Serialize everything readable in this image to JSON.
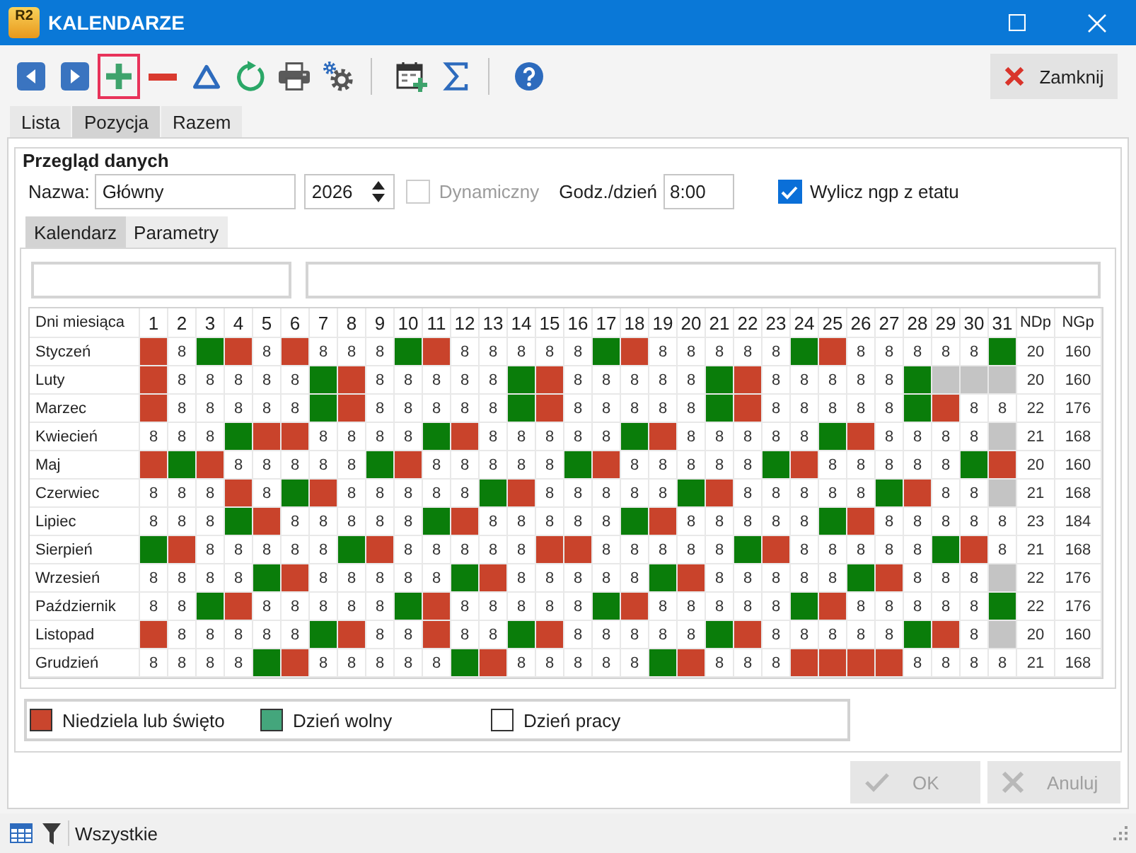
{
  "window": {
    "logo": "R2",
    "title": "KALENDARZE"
  },
  "toolbar": {
    "groups": [
      [
        {
          "kind": "previous",
          "highlighted": false
        },
        {
          "kind": "next",
          "highlighted": false
        },
        {
          "kind": "add",
          "highlighted": true
        },
        {
          "kind": "remove",
          "highlighted": false
        },
        {
          "kind": "delta",
          "highlighted": false
        },
        {
          "kind": "refresh",
          "highlighted": false
        },
        {
          "kind": "print",
          "highlighted": false
        },
        {
          "kind": "settings",
          "highlighted": false
        }
      ],
      [
        {
          "kind": "calendar_add",
          "highlighted": false
        },
        {
          "kind": "sum",
          "highlighted": false
        }
      ],
      [
        {
          "kind": "help",
          "highlighted": false
        }
      ]
    ],
    "close_button": "Zamknij"
  },
  "tabs": [
    {
      "label": "Lista",
      "selected": false
    },
    {
      "label": "Pozycja",
      "selected": true
    },
    {
      "label": "Razem",
      "selected": false
    }
  ],
  "form": {
    "section_title": "Przegląd danych",
    "name_label": "Nazwa:",
    "name_value": "Główny",
    "year": "2026",
    "dynamic": {
      "label": "Dynamiczny",
      "checked": false,
      "disabled": true
    },
    "hours_label": "Godz./dzień",
    "hours_value": "8:00",
    "auto_ngp": {
      "label": "Wylicz ngp z etatu",
      "checked": true,
      "disabled": false
    }
  },
  "subtabs": [
    {
      "label": "Kalendarz",
      "selected": true
    },
    {
      "label": "Parametry",
      "selected": false
    }
  ],
  "grid": {
    "columns": [
      "Dni miesiąca",
      "1",
      "2",
      "3",
      "4",
      "5",
      "6",
      "7",
      "8",
      "9",
      "10",
      "11",
      "12",
      "13",
      "14",
      "15",
      "16",
      "17",
      "18",
      "19",
      "20",
      "21",
      "22",
      "23",
      "24",
      "25",
      "26",
      "27",
      "28",
      "29",
      "30",
      "31",
      "NDp",
      "NGp"
    ],
    "rows": [
      {
        "month": "Styczeń",
        "days": [
          {
            "kind": "holiday"
          },
          {
            "kind": "work",
            "text": "8"
          },
          {
            "kind": "free"
          },
          {
            "kind": "holiday"
          },
          {
            "kind": "work",
            "text": "8"
          },
          {
            "kind": "holiday"
          },
          {
            "kind": "work",
            "text": "8"
          },
          {
            "kind": "work",
            "text": "8"
          },
          {
            "kind": "work",
            "text": "8"
          },
          {
            "kind": "free"
          },
          {
            "kind": "holiday"
          },
          {
            "kind": "work",
            "text": "8"
          },
          {
            "kind": "work",
            "text": "8"
          },
          {
            "kind": "work",
            "text": "8"
          },
          {
            "kind": "work",
            "text": "8"
          },
          {
            "kind": "work",
            "text": "8"
          },
          {
            "kind": "free"
          },
          {
            "kind": "holiday"
          },
          {
            "kind": "work",
            "text": "8"
          },
          {
            "kind": "work",
            "text": "8"
          },
          {
            "kind": "work",
            "text": "8"
          },
          {
            "kind": "work",
            "text": "8"
          },
          {
            "kind": "work",
            "text": "8"
          },
          {
            "kind": "free"
          },
          {
            "kind": "holiday"
          },
          {
            "kind": "work",
            "text": "8"
          },
          {
            "kind": "work",
            "text": "8"
          },
          {
            "kind": "work",
            "text": "8"
          },
          {
            "kind": "work",
            "text": "8"
          },
          {
            "kind": "work",
            "text": "8"
          },
          {
            "kind": "free"
          }
        ],
        "ndp": "20",
        "ngp": "160"
      },
      {
        "month": "Luty",
        "days": [
          {
            "kind": "holiday"
          },
          {
            "kind": "work",
            "text": "8"
          },
          {
            "kind": "work",
            "text": "8"
          },
          {
            "kind": "work",
            "text": "8"
          },
          {
            "kind": "work",
            "text": "8"
          },
          {
            "kind": "work",
            "text": "8"
          },
          {
            "kind": "free"
          },
          {
            "kind": "holiday"
          },
          {
            "kind": "work",
            "text": "8"
          },
          {
            "kind": "work",
            "text": "8"
          },
          {
            "kind": "work",
            "text": "8"
          },
          {
            "kind": "work",
            "text": "8"
          },
          {
            "kind": "work",
            "text": "8"
          },
          {
            "kind": "free"
          },
          {
            "kind": "holiday"
          },
          {
            "kind": "work",
            "text": "8"
          },
          {
            "kind": "work",
            "text": "8"
          },
          {
            "kind": "work",
            "text": "8"
          },
          {
            "kind": "work",
            "text": "8"
          },
          {
            "kind": "work",
            "text": "8"
          },
          {
            "kind": "free"
          },
          {
            "kind": "holiday"
          },
          {
            "kind": "work",
            "text": "8"
          },
          {
            "kind": "work",
            "text": "8"
          },
          {
            "kind": "work",
            "text": "8"
          },
          {
            "kind": "work",
            "text": "8"
          },
          {
            "kind": "work",
            "text": "8"
          },
          {
            "kind": "free"
          },
          {
            "kind": "none"
          },
          {
            "kind": "none"
          },
          {
            "kind": "none"
          }
        ],
        "ndp": "20",
        "ngp": "160"
      },
      {
        "month": "Marzec",
        "days": [
          {
            "kind": "holiday"
          },
          {
            "kind": "work",
            "text": "8"
          },
          {
            "kind": "work",
            "text": "8"
          },
          {
            "kind": "work",
            "text": "8"
          },
          {
            "kind": "work",
            "text": "8"
          },
          {
            "kind": "work",
            "text": "8"
          },
          {
            "kind": "free"
          },
          {
            "kind": "holiday"
          },
          {
            "kind": "work",
            "text": "8"
          },
          {
            "kind": "work",
            "text": "8"
          },
          {
            "kind": "work",
            "text": "8"
          },
          {
            "kind": "work",
            "text": "8"
          },
          {
            "kind": "work",
            "text": "8"
          },
          {
            "kind": "free"
          },
          {
            "kind": "holiday"
          },
          {
            "kind": "work",
            "text": "8"
          },
          {
            "kind": "work",
            "text": "8"
          },
          {
            "kind": "work",
            "text": "8"
          },
          {
            "kind": "work",
            "text": "8"
          },
          {
            "kind": "work",
            "text": "8"
          },
          {
            "kind": "free"
          },
          {
            "kind": "holiday"
          },
          {
            "kind": "work",
            "text": "8"
          },
          {
            "kind": "work",
            "text": "8"
          },
          {
            "kind": "work",
            "text": "8"
          },
          {
            "kind": "work",
            "text": "8"
          },
          {
            "kind": "work",
            "text": "8"
          },
          {
            "kind": "free"
          },
          {
            "kind": "holiday"
          },
          {
            "kind": "work",
            "text": "8"
          },
          {
            "kind": "work",
            "text": "8"
          }
        ],
        "ndp": "22",
        "ngp": "176"
      },
      {
        "month": "Kwiecień",
        "days": [
          {
            "kind": "work",
            "text": "8"
          },
          {
            "kind": "work",
            "text": "8"
          },
          {
            "kind": "work",
            "text": "8"
          },
          {
            "kind": "free"
          },
          {
            "kind": "holiday"
          },
          {
            "kind": "holiday"
          },
          {
            "kind": "work",
            "text": "8"
          },
          {
            "kind": "work",
            "text": "8"
          },
          {
            "kind": "work",
            "text": "8"
          },
          {
            "kind": "work",
            "text": "8"
          },
          {
            "kind": "free"
          },
          {
            "kind": "holiday"
          },
          {
            "kind": "work",
            "text": "8"
          },
          {
            "kind": "work",
            "text": "8"
          },
          {
            "kind": "work",
            "text": "8"
          },
          {
            "kind": "work",
            "text": "8"
          },
          {
            "kind": "work",
            "text": "8"
          },
          {
            "kind": "free"
          },
          {
            "kind": "holiday"
          },
          {
            "kind": "work",
            "text": "8"
          },
          {
            "kind": "work",
            "text": "8"
          },
          {
            "kind": "work",
            "text": "8"
          },
          {
            "kind": "work",
            "text": "8"
          },
          {
            "kind": "work",
            "text": "8"
          },
          {
            "kind": "free"
          },
          {
            "kind": "holiday"
          },
          {
            "kind": "work",
            "text": "8"
          },
          {
            "kind": "work",
            "text": "8"
          },
          {
            "kind": "work",
            "text": "8"
          },
          {
            "kind": "work",
            "text": "8"
          },
          {
            "kind": "none"
          }
        ],
        "ndp": "21",
        "ngp": "168"
      },
      {
        "month": "Maj",
        "days": [
          {
            "kind": "holiday"
          },
          {
            "kind": "free"
          },
          {
            "kind": "holiday"
          },
          {
            "kind": "work",
            "text": "8"
          },
          {
            "kind": "work",
            "text": "8"
          },
          {
            "kind": "work",
            "text": "8"
          },
          {
            "kind": "work",
            "text": "8"
          },
          {
            "kind": "work",
            "text": "8"
          },
          {
            "kind": "free"
          },
          {
            "kind": "holiday"
          },
          {
            "kind": "work",
            "text": "8"
          },
          {
            "kind": "work",
            "text": "8"
          },
          {
            "kind": "work",
            "text": "8"
          },
          {
            "kind": "work",
            "text": "8"
          },
          {
            "kind": "work",
            "text": "8"
          },
          {
            "kind": "free"
          },
          {
            "kind": "holiday"
          },
          {
            "kind": "work",
            "text": "8"
          },
          {
            "kind": "work",
            "text": "8"
          },
          {
            "kind": "work",
            "text": "8"
          },
          {
            "kind": "work",
            "text": "8"
          },
          {
            "kind": "work",
            "text": "8"
          },
          {
            "kind": "free"
          },
          {
            "kind": "holiday"
          },
          {
            "kind": "work",
            "text": "8"
          },
          {
            "kind": "work",
            "text": "8"
          },
          {
            "kind": "work",
            "text": "8"
          },
          {
            "kind": "work",
            "text": "8"
          },
          {
            "kind": "work",
            "text": "8"
          },
          {
            "kind": "free"
          },
          {
            "kind": "holiday"
          }
        ],
        "ndp": "20",
        "ngp": "160"
      },
      {
        "month": "Czerwiec",
        "days": [
          {
            "kind": "work",
            "text": "8"
          },
          {
            "kind": "work",
            "text": "8"
          },
          {
            "kind": "work",
            "text": "8"
          },
          {
            "kind": "holiday"
          },
          {
            "kind": "work",
            "text": "8"
          },
          {
            "kind": "free"
          },
          {
            "kind": "holiday"
          },
          {
            "kind": "work",
            "text": "8"
          },
          {
            "kind": "work",
            "text": "8"
          },
          {
            "kind": "work",
            "text": "8"
          },
          {
            "kind": "work",
            "text": "8"
          },
          {
            "kind": "work",
            "text": "8"
          },
          {
            "kind": "free"
          },
          {
            "kind": "holiday"
          },
          {
            "kind": "work",
            "text": "8"
          },
          {
            "kind": "work",
            "text": "8"
          },
          {
            "kind": "work",
            "text": "8"
          },
          {
            "kind": "work",
            "text": "8"
          },
          {
            "kind": "work",
            "text": "8"
          },
          {
            "kind": "free"
          },
          {
            "kind": "holiday"
          },
          {
            "kind": "work",
            "text": "8"
          },
          {
            "kind": "work",
            "text": "8"
          },
          {
            "kind": "work",
            "text": "8"
          },
          {
            "kind": "work",
            "text": "8"
          },
          {
            "kind": "work",
            "text": "8"
          },
          {
            "kind": "free"
          },
          {
            "kind": "holiday"
          },
          {
            "kind": "work",
            "text": "8"
          },
          {
            "kind": "work",
            "text": "8"
          },
          {
            "kind": "none"
          }
        ],
        "ndp": "21",
        "ngp": "168"
      },
      {
        "month": "Lipiec",
        "days": [
          {
            "kind": "work",
            "text": "8"
          },
          {
            "kind": "work",
            "text": "8"
          },
          {
            "kind": "work",
            "text": "8"
          },
          {
            "kind": "free"
          },
          {
            "kind": "holiday"
          },
          {
            "kind": "work",
            "text": "8"
          },
          {
            "kind": "work",
            "text": "8"
          },
          {
            "kind": "work",
            "text": "8"
          },
          {
            "kind": "work",
            "text": "8"
          },
          {
            "kind": "work",
            "text": "8"
          },
          {
            "kind": "free"
          },
          {
            "kind": "holiday"
          },
          {
            "kind": "work",
            "text": "8"
          },
          {
            "kind": "work",
            "text": "8"
          },
          {
            "kind": "work",
            "text": "8"
          },
          {
            "kind": "work",
            "text": "8"
          },
          {
            "kind": "work",
            "text": "8"
          },
          {
            "kind": "free"
          },
          {
            "kind": "holiday"
          },
          {
            "kind": "work",
            "text": "8"
          },
          {
            "kind": "work",
            "text": "8"
          },
          {
            "kind": "work",
            "text": "8"
          },
          {
            "kind": "work",
            "text": "8"
          },
          {
            "kind": "work",
            "text": "8"
          },
          {
            "kind": "free"
          },
          {
            "kind": "holiday"
          },
          {
            "kind": "work",
            "text": "8"
          },
          {
            "kind": "work",
            "text": "8"
          },
          {
            "kind": "work",
            "text": "8"
          },
          {
            "kind": "work",
            "text": "8"
          },
          {
            "kind": "work",
            "text": "8"
          }
        ],
        "ndp": "23",
        "ngp": "184"
      },
      {
        "month": "Sierpień",
        "days": [
          {
            "kind": "free"
          },
          {
            "kind": "holiday"
          },
          {
            "kind": "work",
            "text": "8"
          },
          {
            "kind": "work",
            "text": "8"
          },
          {
            "kind": "work",
            "text": "8"
          },
          {
            "kind": "work",
            "text": "8"
          },
          {
            "kind": "work",
            "text": "8"
          },
          {
            "kind": "free"
          },
          {
            "kind": "holiday"
          },
          {
            "kind": "work",
            "text": "8"
          },
          {
            "kind": "work",
            "text": "8"
          },
          {
            "kind": "work",
            "text": "8"
          },
          {
            "kind": "work",
            "text": "8"
          },
          {
            "kind": "work",
            "text": "8"
          },
          {
            "kind": "holiday"
          },
          {
            "kind": "holiday"
          },
          {
            "kind": "work",
            "text": "8"
          },
          {
            "kind": "work",
            "text": "8"
          },
          {
            "kind": "work",
            "text": "8"
          },
          {
            "kind": "work",
            "text": "8"
          },
          {
            "kind": "work",
            "text": "8"
          },
          {
            "kind": "free"
          },
          {
            "kind": "holiday"
          },
          {
            "kind": "work",
            "text": "8"
          },
          {
            "kind": "work",
            "text": "8"
          },
          {
            "kind": "work",
            "text": "8"
          },
          {
            "kind": "work",
            "text": "8"
          },
          {
            "kind": "work",
            "text": "8"
          },
          {
            "kind": "free"
          },
          {
            "kind": "holiday"
          },
          {
            "kind": "work",
            "text": "8"
          }
        ],
        "ndp": "21",
        "ngp": "168"
      },
      {
        "month": "Wrzesień",
        "days": [
          {
            "kind": "work",
            "text": "8"
          },
          {
            "kind": "work",
            "text": "8"
          },
          {
            "kind": "work",
            "text": "8"
          },
          {
            "kind": "work",
            "text": "8"
          },
          {
            "kind": "free"
          },
          {
            "kind": "holiday"
          },
          {
            "kind": "work",
            "text": "8"
          },
          {
            "kind": "work",
            "text": "8"
          },
          {
            "kind": "work",
            "text": "8"
          },
          {
            "kind": "work",
            "text": "8"
          },
          {
            "kind": "work",
            "text": "8"
          },
          {
            "kind": "free"
          },
          {
            "kind": "holiday"
          },
          {
            "kind": "work",
            "text": "8"
          },
          {
            "kind": "work",
            "text": "8"
          },
          {
            "kind": "work",
            "text": "8"
          },
          {
            "kind": "work",
            "text": "8"
          },
          {
            "kind": "work",
            "text": "8"
          },
          {
            "kind": "free"
          },
          {
            "kind": "holiday"
          },
          {
            "kind": "work",
            "text": "8"
          },
          {
            "kind": "work",
            "text": "8"
          },
          {
            "kind": "work",
            "text": "8"
          },
          {
            "kind": "work",
            "text": "8"
          },
          {
            "kind": "work",
            "text": "8"
          },
          {
            "kind": "free"
          },
          {
            "kind": "holiday"
          },
          {
            "kind": "work",
            "text": "8"
          },
          {
            "kind": "work",
            "text": "8"
          },
          {
            "kind": "work",
            "text": "8"
          },
          {
            "kind": "none"
          }
        ],
        "ndp": "22",
        "ngp": "176"
      },
      {
        "month": "Październik",
        "days": [
          {
            "kind": "work",
            "text": "8"
          },
          {
            "kind": "work",
            "text": "8"
          },
          {
            "kind": "free"
          },
          {
            "kind": "holiday"
          },
          {
            "kind": "work",
            "text": "8"
          },
          {
            "kind": "work",
            "text": "8"
          },
          {
            "kind": "work",
            "text": "8"
          },
          {
            "kind": "work",
            "text": "8"
          },
          {
            "kind": "work",
            "text": "8"
          },
          {
            "kind": "free"
          },
          {
            "kind": "holiday"
          },
          {
            "kind": "work",
            "text": "8"
          },
          {
            "kind": "work",
            "text": "8"
          },
          {
            "kind": "work",
            "text": "8"
          },
          {
            "kind": "work",
            "text": "8"
          },
          {
            "kind": "work",
            "text": "8"
          },
          {
            "kind": "free"
          },
          {
            "kind": "holiday"
          },
          {
            "kind": "work",
            "text": "8"
          },
          {
            "kind": "work",
            "text": "8"
          },
          {
            "kind": "work",
            "text": "8"
          },
          {
            "kind": "work",
            "text": "8"
          },
          {
            "kind": "work",
            "text": "8"
          },
          {
            "kind": "free"
          },
          {
            "kind": "holiday"
          },
          {
            "kind": "work",
            "text": "8"
          },
          {
            "kind": "work",
            "text": "8"
          },
          {
            "kind": "work",
            "text": "8"
          },
          {
            "kind": "work",
            "text": "8"
          },
          {
            "kind": "work",
            "text": "8"
          },
          {
            "kind": "free"
          }
        ],
        "ndp": "22",
        "ngp": "176"
      },
      {
        "month": "Listopad",
        "days": [
          {
            "kind": "holiday"
          },
          {
            "kind": "work",
            "text": "8"
          },
          {
            "kind": "work",
            "text": "8"
          },
          {
            "kind": "work",
            "text": "8"
          },
          {
            "kind": "work",
            "text": "8"
          },
          {
            "kind": "work",
            "text": "8"
          },
          {
            "kind": "free"
          },
          {
            "kind": "holiday"
          },
          {
            "kind": "work",
            "text": "8"
          },
          {
            "kind": "work",
            "text": "8"
          },
          {
            "kind": "holiday"
          },
          {
            "kind": "work",
            "text": "8"
          },
          {
            "kind": "work",
            "text": "8"
          },
          {
            "kind": "free"
          },
          {
            "kind": "holiday"
          },
          {
            "kind": "work",
            "text": "8"
          },
          {
            "kind": "work",
            "text": "8"
          },
          {
            "kind": "work",
            "text": "8"
          },
          {
            "kind": "work",
            "text": "8"
          },
          {
            "kind": "work",
            "text": "8"
          },
          {
            "kind": "free"
          },
          {
            "kind": "holiday"
          },
          {
            "kind": "work",
            "text": "8"
          },
          {
            "kind": "work",
            "text": "8"
          },
          {
            "kind": "work",
            "text": "8"
          },
          {
            "kind": "work",
            "text": "8"
          },
          {
            "kind": "work",
            "text": "8"
          },
          {
            "kind": "free"
          },
          {
            "kind": "holiday"
          },
          {
            "kind": "work",
            "text": "8"
          },
          {
            "kind": "none"
          }
        ],
        "ndp": "20",
        "ngp": "160"
      },
      {
        "month": "Grudzień",
        "days": [
          {
            "kind": "work",
            "text": "8"
          },
          {
            "kind": "work",
            "text": "8"
          },
          {
            "kind": "work",
            "text": "8"
          },
          {
            "kind": "work",
            "text": "8"
          },
          {
            "kind": "free"
          },
          {
            "kind": "holiday"
          },
          {
            "kind": "work",
            "text": "8"
          },
          {
            "kind": "work",
            "text": "8"
          },
          {
            "kind": "work",
            "text": "8"
          },
          {
            "kind": "work",
            "text": "8"
          },
          {
            "kind": "work",
            "text": "8"
          },
          {
            "kind": "free"
          },
          {
            "kind": "holiday"
          },
          {
            "kind": "work",
            "text": "8"
          },
          {
            "kind": "work",
            "text": "8"
          },
          {
            "kind": "work",
            "text": "8"
          },
          {
            "kind": "work",
            "text": "8"
          },
          {
            "kind": "work",
            "text": "8"
          },
          {
            "kind": "free"
          },
          {
            "kind": "holiday"
          },
          {
            "kind": "work",
            "text": "8"
          },
          {
            "kind": "work",
            "text": "8"
          },
          {
            "kind": "work",
            "text": "8"
          },
          {
            "kind": "holiday"
          },
          {
            "kind": "holiday"
          },
          {
            "kind": "holiday"
          },
          {
            "kind": "holiday"
          },
          {
            "kind": "work",
            "text": "8"
          },
          {
            "kind": "work",
            "text": "8"
          },
          {
            "kind": "work",
            "text": "8"
          },
          {
            "kind": "work",
            "text": "8"
          }
        ],
        "ndp": "21",
        "ngp": "168"
      }
    ]
  },
  "legend": [
    {
      "label": "Niedziela lub święto",
      "color": "#c9452d"
    },
    {
      "label": "Dzień wolny",
      "color": "#44a67c"
    },
    {
      "label": "Dzień pracy",
      "color": "#ffffff"
    }
  ],
  "buttons": [
    {
      "kind": "ok",
      "label": "OK",
      "disabled": true
    },
    {
      "kind": "cancel",
      "label": "Anuluj",
      "disabled": true
    }
  ],
  "status_bar": {
    "filter": "Wszystkie"
  }
}
